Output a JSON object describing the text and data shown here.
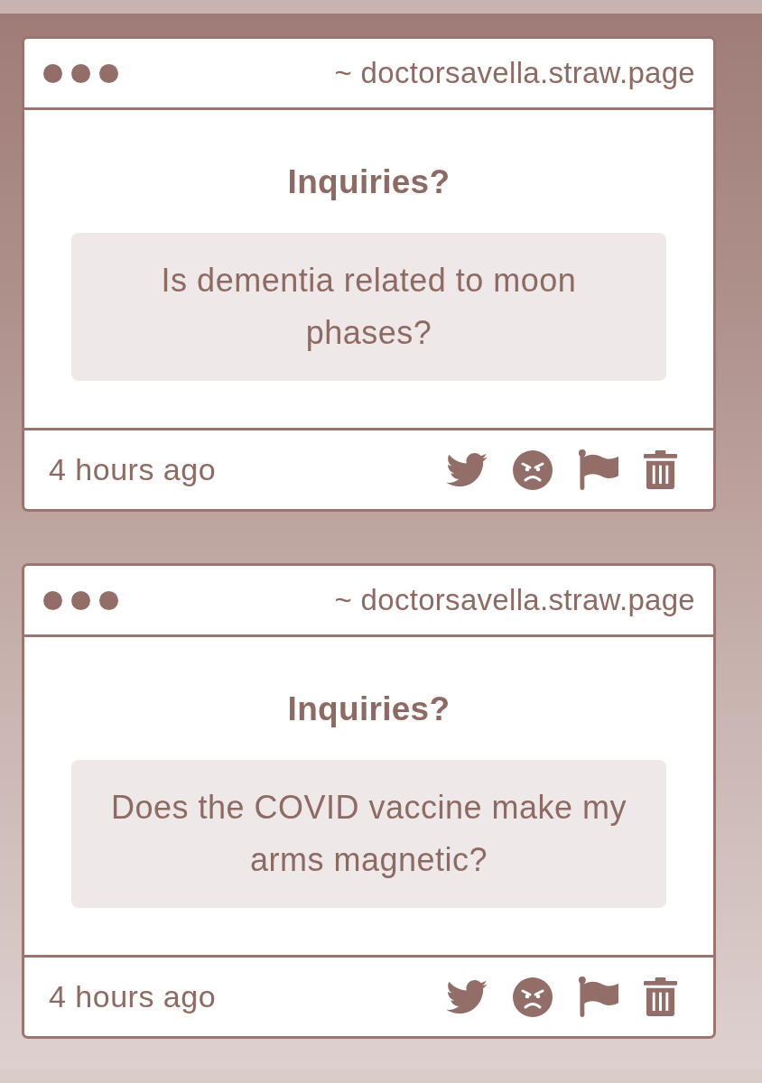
{
  "cards": [
    {
      "url": "~ doctorsavella.straw.page",
      "heading": "Inquiries?",
      "question": "Is dementia related to moon phases?",
      "time": "4 hours ago"
    },
    {
      "url": "~ doctorsavella.straw.page",
      "heading": "Inquiries?",
      "question": "Does the COVID vaccine make my arms magnetic?",
      "time": "4 hours ago"
    }
  ]
}
